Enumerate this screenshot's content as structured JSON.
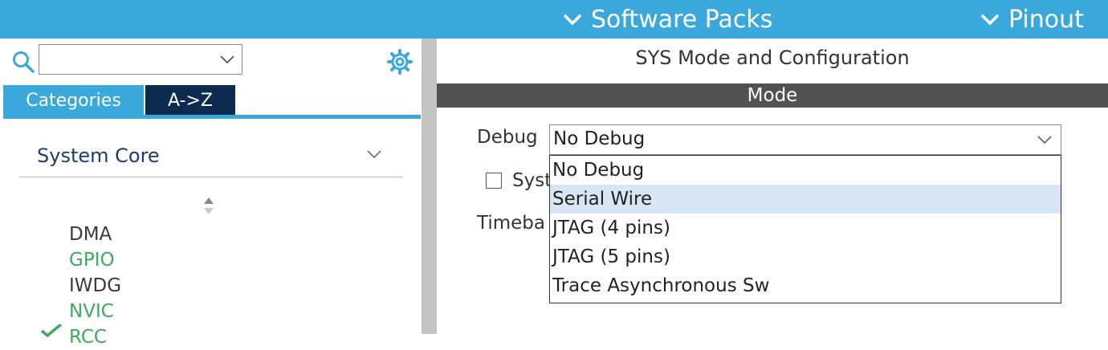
{
  "topbar": {
    "software_packs": "Software Packs",
    "pinout": "Pinout",
    "color": "#3aa8db"
  },
  "left": {
    "search": {
      "value": "",
      "placeholder": ""
    },
    "tabs": [
      {
        "label": "Categories",
        "active": true
      },
      {
        "label": "A->Z",
        "active": false
      }
    ],
    "section": {
      "label": "System Core"
    },
    "categories": [
      {
        "label": "DMA",
        "status": "default"
      },
      {
        "label": "GPIO",
        "status": "configured"
      },
      {
        "label": "IWDG",
        "status": "default"
      },
      {
        "label": "NVIC",
        "status": "configured"
      },
      {
        "label": "RCC",
        "status": "configured-checked"
      }
    ]
  },
  "right": {
    "title": "SYS Mode and Configuration",
    "mode_header": "Mode",
    "debug": {
      "label": "Debug",
      "value": "No Debug",
      "options": [
        "No Debug",
        "Serial Wire",
        "JTAG (4 pins)",
        "JTAG (5 pins)",
        "Trace Asynchronous Sw"
      ],
      "highlighted": "Serial Wire"
    },
    "sys_checkbox_label": "Syst",
    "timebase_label": "Timeba"
  },
  "icons": {
    "search": "search-icon",
    "gear": "gear-icon",
    "chevron": "chevron-down-icon",
    "sort": "sort-icon",
    "check": "check-icon"
  },
  "colors": {
    "accent": "#3aa8db",
    "dark_tab": "#0d2b4e",
    "configured": "#3faa5c",
    "mode_bar": "#525252",
    "highlight": "#d8e6f3"
  }
}
